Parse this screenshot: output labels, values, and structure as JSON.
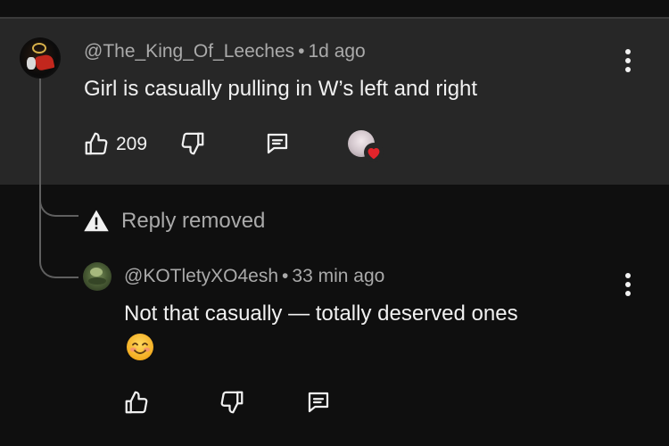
{
  "comment": {
    "author": "@The_King_Of_Leeches",
    "separator": "•",
    "time": "1d ago",
    "text": "Girl is casually pulling in W’s left and right",
    "like_count": "209"
  },
  "removed_notice": {
    "text": "Reply removed",
    "icon": "warning-icon"
  },
  "reply": {
    "author": "@KOTletyXO4esh",
    "separator": "•",
    "time": "33 min ago",
    "text": "Not that casually — totally deserved ones",
    "emoji": "smiling-face-emoji"
  },
  "colors": {
    "background": "#0f0f0f",
    "highlight": "#272727",
    "text_primary": "#f1f1f1",
    "text_secondary": "#aaaaaa",
    "heart": "#e3242b"
  },
  "icons": [
    "thumbs-up-icon",
    "thumbs-down-icon",
    "reply-icon",
    "more-vert-icon",
    "creator-heart-icon"
  ]
}
